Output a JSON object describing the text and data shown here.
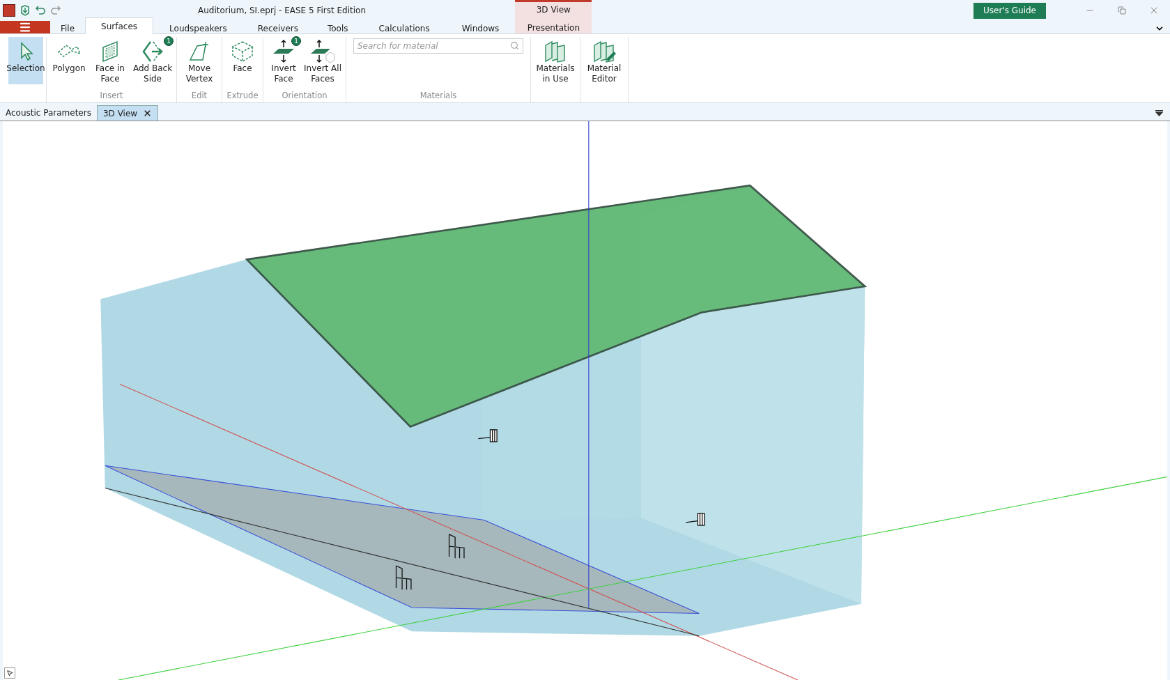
{
  "window": {
    "title": "Auditorium, SI.eprj - EASE 5 First Edition",
    "guide_button": "User's Guide"
  },
  "menu_tabs": [
    {
      "label": "File",
      "selected": false
    },
    {
      "label": "Surfaces",
      "selected": true
    },
    {
      "label": "Loudspeakers",
      "selected": false
    },
    {
      "label": "Receivers",
      "selected": false
    },
    {
      "label": "Tools",
      "selected": false
    },
    {
      "label": "Calculations",
      "selected": false
    },
    {
      "label": "Windows",
      "selected": false
    }
  ],
  "context_tab": {
    "group": "3D View",
    "label": "Presentation",
    "selected": false
  },
  "ribbon": [
    {
      "buttons": [
        {
          "label": "Selection",
          "selected": true
        }
      ]
    },
    {
      "label": "Insert",
      "buttons": [
        {
          "label": "Polygon",
          "selected": false
        },
        {
          "label": "Face in Face",
          "selected": false
        },
        {
          "label": "Add Back Side",
          "selected": false,
          "badge": "1"
        }
      ]
    },
    {
      "label": "Edit",
      "buttons": [
        {
          "label": "Move Vertex",
          "selected": false
        }
      ]
    },
    {
      "label": "Extrude",
      "buttons": [
        {
          "label": "Face",
          "selected": false
        }
      ]
    },
    {
      "label": "Orientation",
      "buttons": [
        {
          "label": "Invert Face",
          "selected": false,
          "badge": "1"
        },
        {
          "label": "Invert All Faces",
          "selected": false
        }
      ]
    },
    {
      "label": "Materials",
      "search": {
        "placeholder": "Search for material"
      }
    },
    {
      "buttons": [
        {
          "label": "Materials in Use",
          "selected": false
        }
      ]
    },
    {
      "buttons": [
        {
          "label": "Material Editor",
          "selected": false
        }
      ]
    }
  ],
  "doc_tabs": [
    {
      "label": "Acoustic Parameters",
      "selected": false
    },
    {
      "label": "3D View",
      "selected": true,
      "closable": true
    }
  ]
}
